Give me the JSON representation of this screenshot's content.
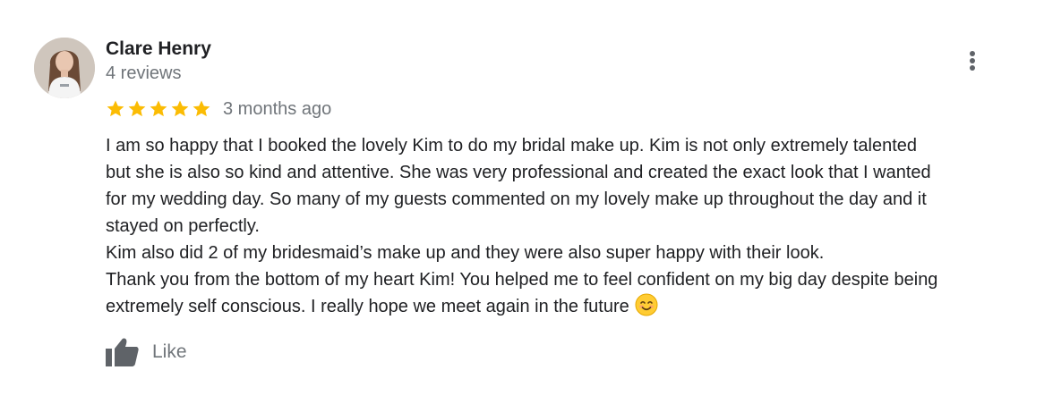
{
  "review": {
    "author": "Clare Henry",
    "review_count": "4 reviews",
    "rating": 5,
    "rating_max": 5,
    "age": "3 months ago",
    "body_lines": [
      "I am so happy that I booked the lovely Kim to do my bridal make up. Kim is not only extremely talented",
      "but she is also so kind and attentive. She was very professional and created the exact look that I wanted",
      "for my wedding day. So many of my guests commented on my lovely make up throughout the day and it",
      "stayed on perfectly.",
      "Kim also did 2 of my bridesmaid’s make up and they were also super happy with their look.",
      "Thank you from the bottom of my heart Kim! You helped me to feel confident on my big day despite being",
      "extremely self conscious. I really hope we meet again in the future"
    ],
    "emoji": "smiling-face-emoji",
    "like_label": "Like",
    "menu_icon": "more-vertical-icon",
    "star_icon": "star-icon",
    "like_icon": "thumbs-up-icon"
  },
  "colors": {
    "star": "#fbbc04",
    "secondary_text": "#70757a",
    "primary_text": "#202124",
    "icon_gray": "#5f6368"
  }
}
